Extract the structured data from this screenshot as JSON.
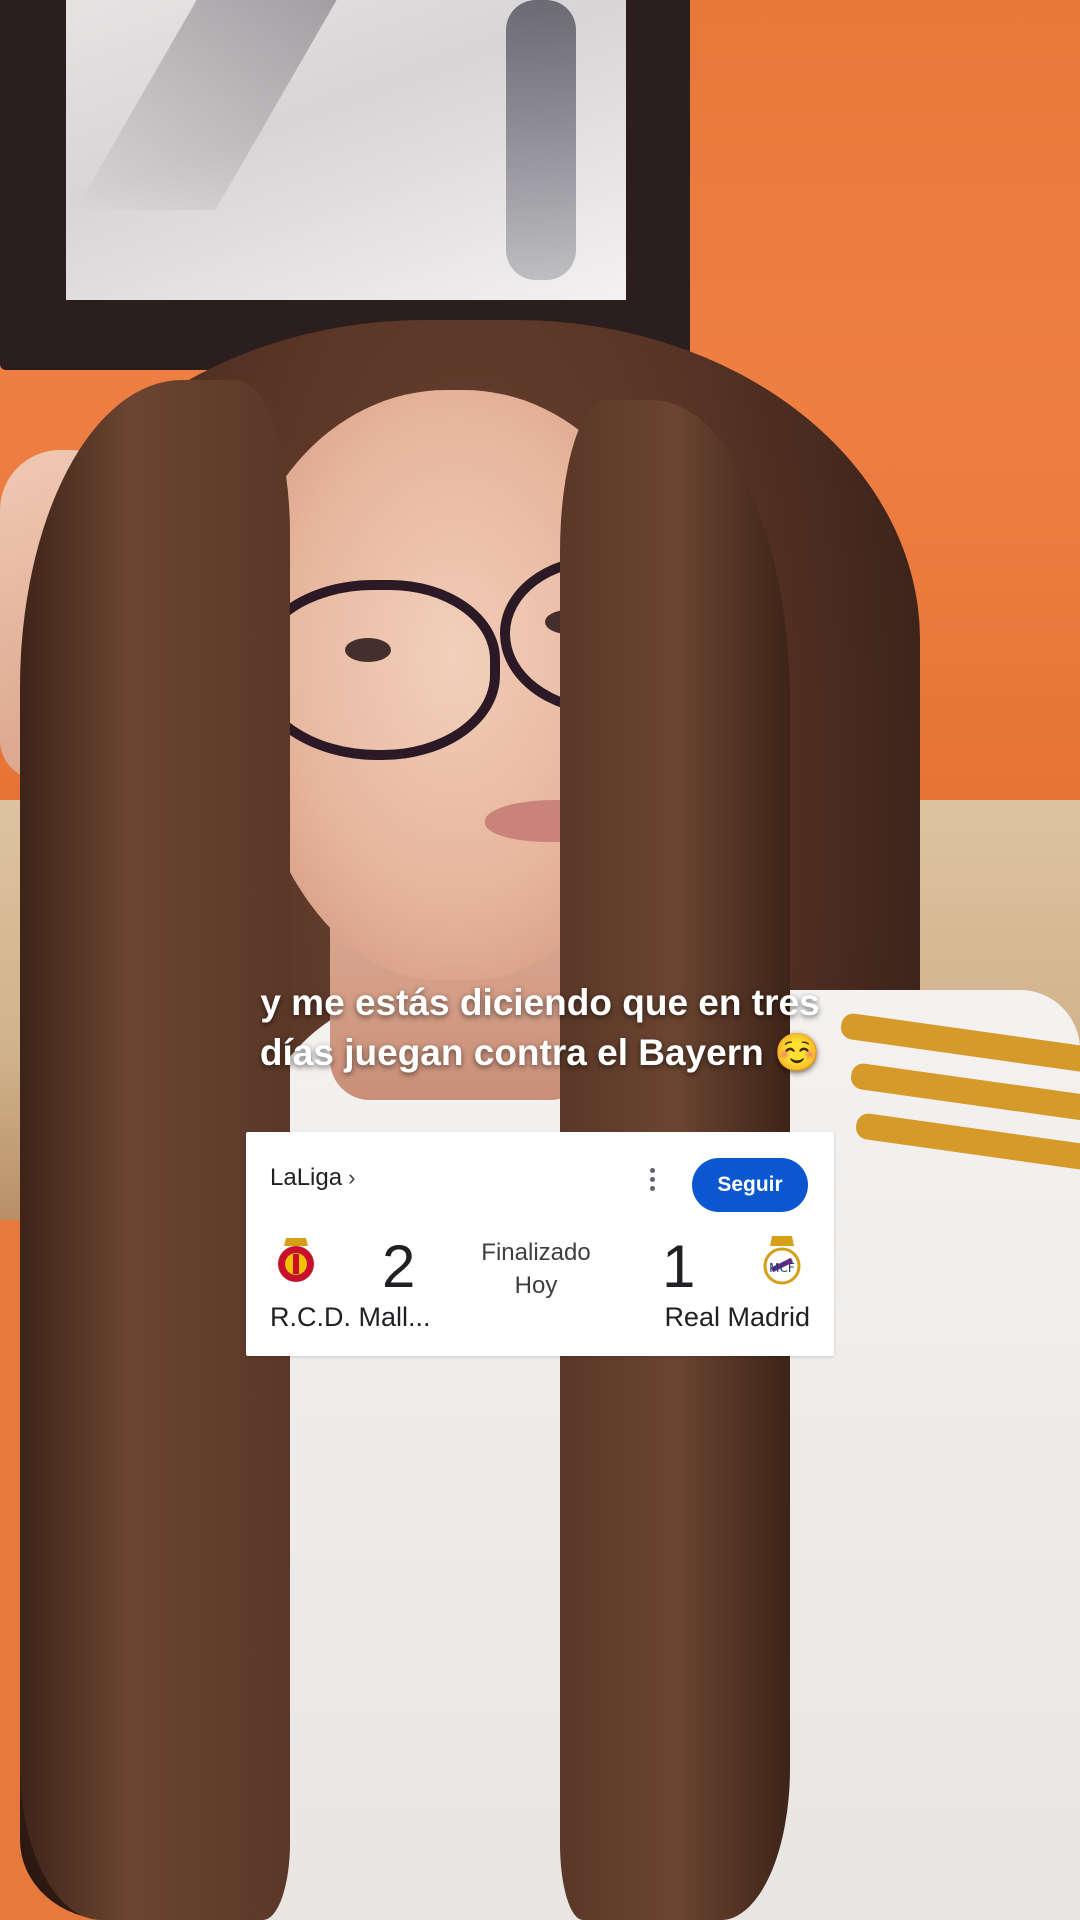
{
  "caption": {
    "line1": "y me estás diciendo que en tres",
    "line2": "días juegan contra el Bayern",
    "emoji": "☺️"
  },
  "scorecard": {
    "league": "LaLiga",
    "league_chevron_icon": "chevron-right-icon",
    "more_icon": "more-vert-icon",
    "follow_label": "Seguir",
    "status": "Finalizado",
    "date": "Hoy",
    "home": {
      "name": "R.C.D. Mall...",
      "score": "2",
      "crest_icon": "rcd-mallorca-crest-icon"
    },
    "away": {
      "name": "Real Madrid",
      "score": "1",
      "crest_icon": "real-madrid-crest-icon"
    },
    "colors": {
      "follow_bg": "#0b57d0",
      "card_bg": "#ffffff",
      "text": "#202124"
    }
  }
}
